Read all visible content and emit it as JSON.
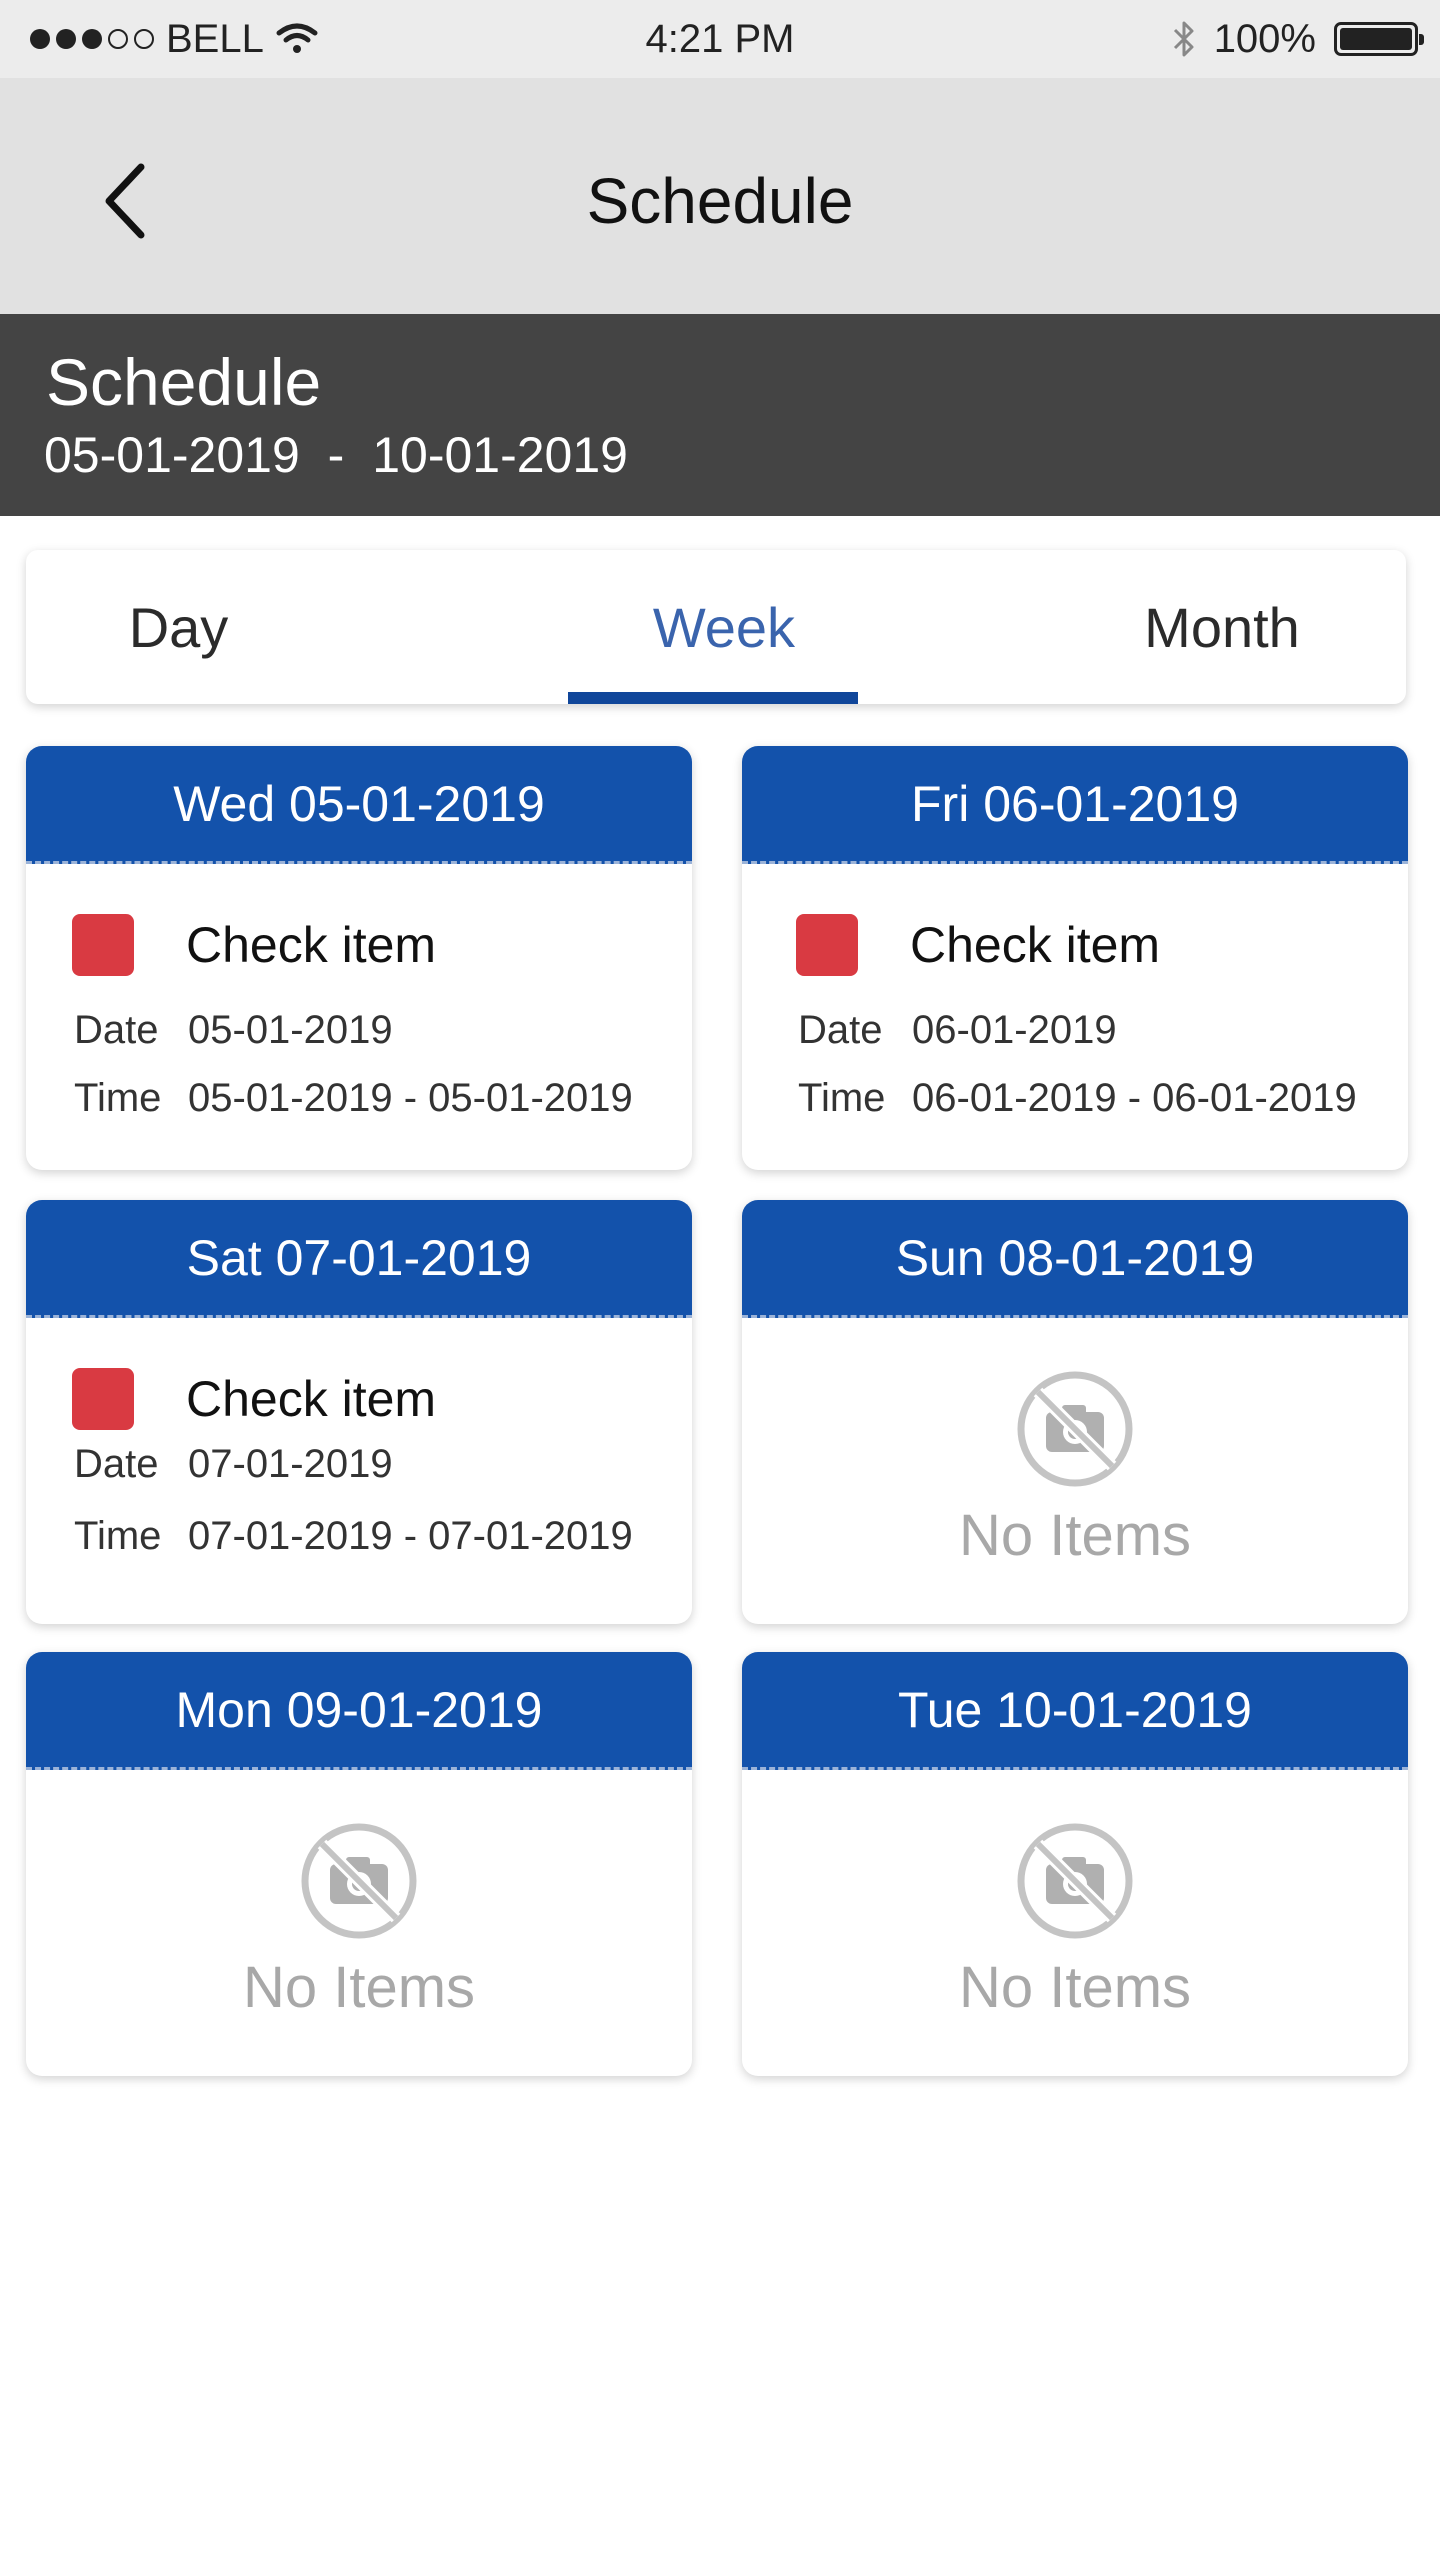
{
  "status_bar": {
    "carrier": "BELL",
    "time": "4:21 PM",
    "battery": "100%"
  },
  "nav": {
    "title": "Schedule"
  },
  "header": {
    "title": "Schedule",
    "start_date": "05-01-2019",
    "separator": " - ",
    "end_date": "10-01-2019"
  },
  "tabs": {
    "day": "Day",
    "week": "Week",
    "month": "Month",
    "selected": "Week"
  },
  "labels": {
    "date": "Date",
    "time": "Time",
    "no_items": "No Items"
  },
  "days": [
    {
      "header": "Wed 05-01-2019",
      "item_title": "Check item",
      "date": "05-01-2019",
      "time": "05-01-2019 - 05-01-2019"
    },
    {
      "header": "Fri 06-01-2019",
      "item_title": "Check item",
      "date": "06-01-2019",
      "time": "06-01-2019 - 06-01-2019"
    },
    {
      "header": "Sat 07-01-2019",
      "item_title": "Check item",
      "date": "07-01-2019",
      "time": "07-01-2019 - 07-01-2019"
    },
    {
      "header": "Sun 08-01-2019"
    },
    {
      "header": "Mon 09-01-2019"
    },
    {
      "header": "Tue 10-01-2019"
    }
  ],
  "colors": {
    "primary": "#1352ab",
    "header_band": "#444444",
    "nav_bar": "#e1e1e1",
    "tab_active": "#3a64ad",
    "item_marker": "#d93a42",
    "muted": "#a8a8a8"
  }
}
